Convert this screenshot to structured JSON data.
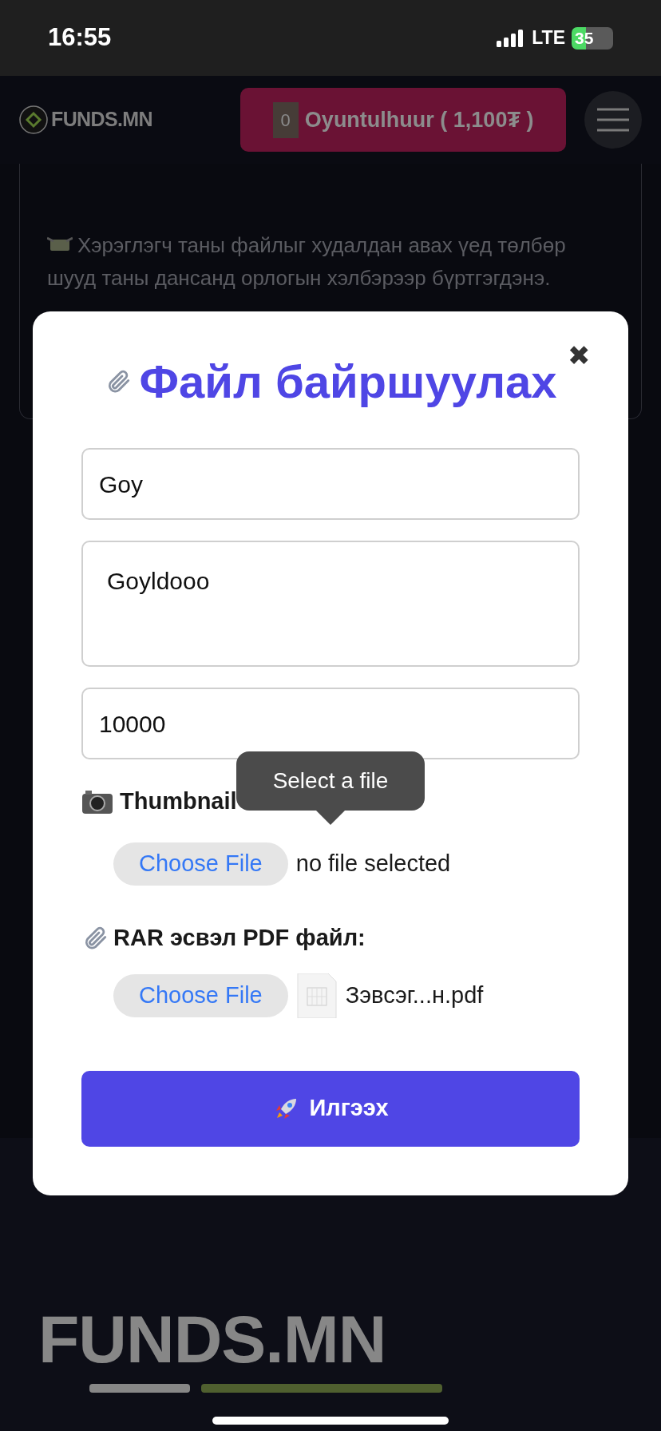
{
  "status_bar": {
    "time": "16:55",
    "network": "LTE",
    "battery": "35"
  },
  "header": {
    "logo": "FUNDS.MN",
    "account_badge": "0",
    "account": "Oyuntulhuur ( 1,100₮ )"
  },
  "background": {
    "paragraph": "Хэрэглэгч таны файлыг худалдан авах үед төлбөр шууд таны дансанд орлогын хэлбэрээр бүртгэгдэнэ."
  },
  "modal": {
    "close": "✖",
    "title": "Файл байршуулах",
    "fields": [
      {
        "kind": "input",
        "value": "Goy"
      },
      {
        "kind": "textarea",
        "value": "Goyldooo"
      },
      {
        "kind": "input",
        "value": "10000"
      }
    ],
    "thumbnail": {
      "label": "Thumbnail",
      "button": "Choose File",
      "status": "no file selected",
      "has_file": false
    },
    "tooltip": "Select a file",
    "attachment": {
      "label": "RAR эсвэл PDF файл:",
      "button": "Choose File",
      "status": "Зэвсэг...н.pdf",
      "has_file": true
    },
    "submit": "Илгээх"
  },
  "footer": {
    "logo": "FUNDS.MN"
  }
}
